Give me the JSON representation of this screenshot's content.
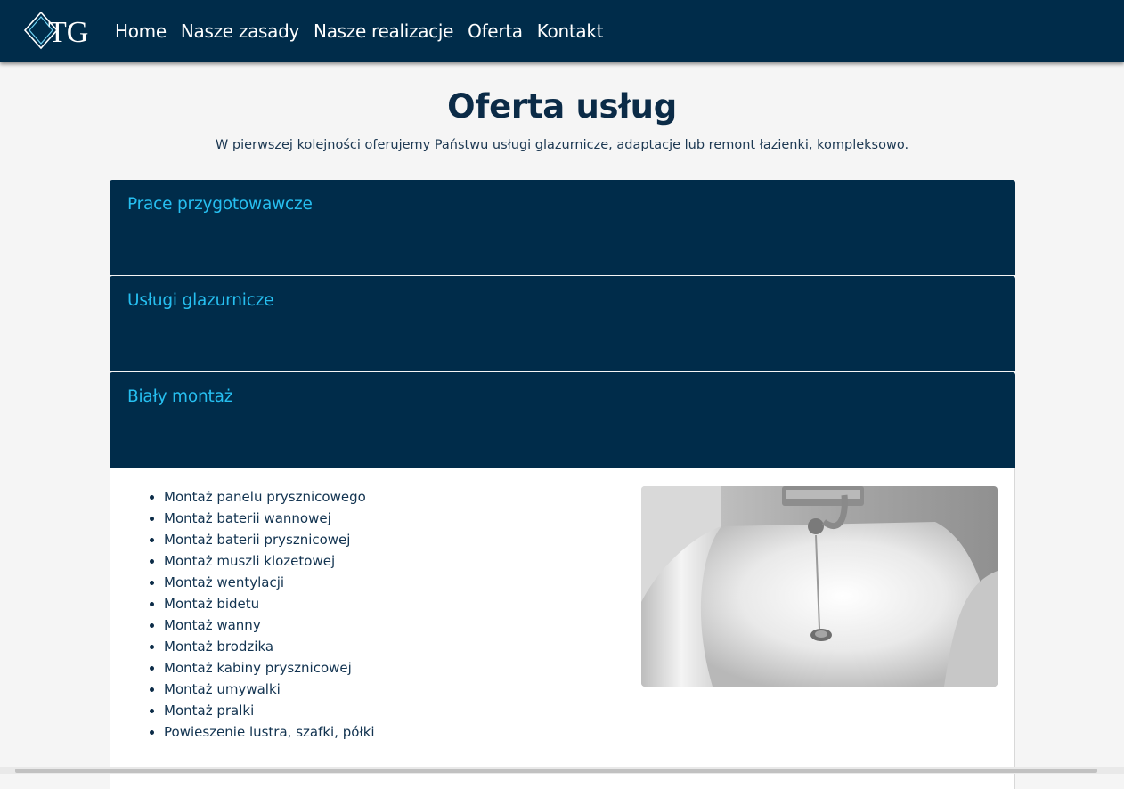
{
  "navbar": {
    "logo_text": "TG",
    "links": [
      "Home",
      "Nasze zasady",
      "Nasze realizacje",
      "Oferta",
      "Kontakt"
    ]
  },
  "page": {
    "title": "Oferta usług",
    "intro": "W pierwszej kolejności oferujemy Państwu usługi glazurnicze, adaptacje lub remont łazienki, kompleksowo."
  },
  "accordion": {
    "sections": [
      {
        "title": "Prace przygotowawcze"
      },
      {
        "title": "Usługi glazurnicze"
      },
      {
        "title": "Biały montaż"
      }
    ],
    "expanded_items": [
      "Montaż panelu prysznicowego",
      "Montaż baterii wannowej",
      "Montaż baterii prysznicowej",
      "Montaż muszli klozetowej",
      "Montaż wentylacji",
      "Montaż bidetu",
      "Montaż wanny",
      "Montaż brodzika",
      "Montaż kabiny prysznicowej",
      "Montaż umywalki",
      "Montaż pralki",
      "Powieszenie lustra, szafki, półki"
    ]
  },
  "colors": {
    "navy": "#002c4a",
    "accent": "#26bff0",
    "background": "#f5f5f5"
  },
  "icons": {
    "logo": "diamond-logo-icon",
    "list_marker": "bullet-icon"
  }
}
